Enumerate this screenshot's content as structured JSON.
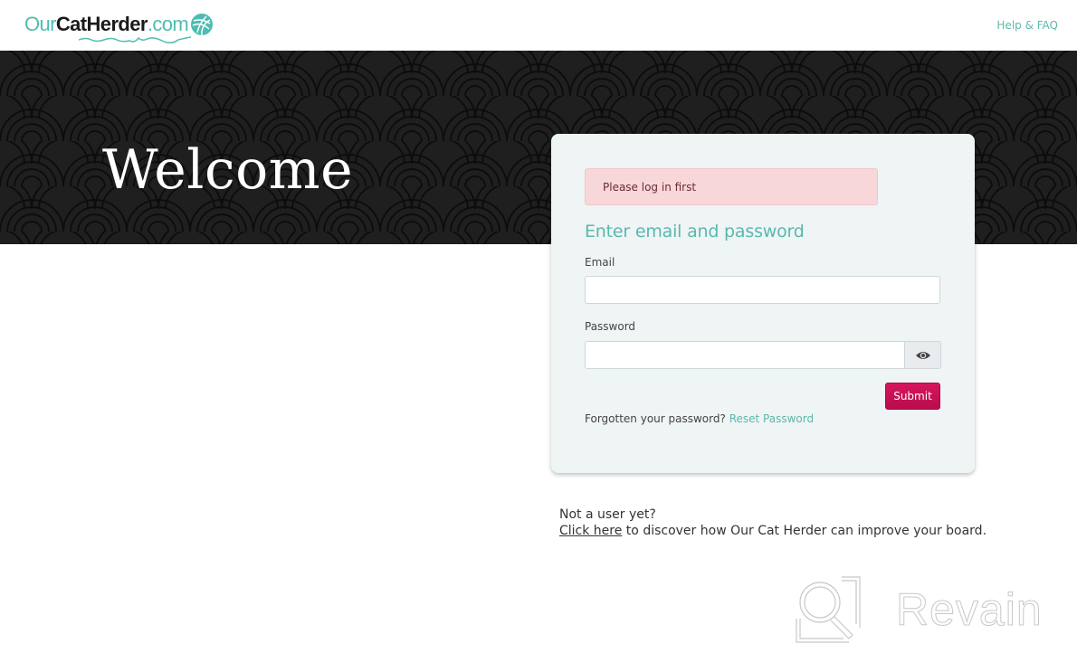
{
  "header": {
    "logo": {
      "part1": "Our",
      "part2": "CatHerder",
      "part3": ".com"
    },
    "help_link": "Help & FAQ"
  },
  "hero": {
    "title": "Welcome"
  },
  "login": {
    "alert": "Please log in first",
    "title": "Enter email and password",
    "email_label": "Email",
    "email_value": "",
    "password_label": "Password",
    "password_value": "",
    "show_password_icon": "eye-icon",
    "submit_label": "Submit",
    "forgot_text": "Forgotten your password?",
    "reset_link": "Reset Password"
  },
  "signup": {
    "question": "Not a user yet?",
    "link": "Click here",
    "text": " to discover how Our Cat Herder can improve your board."
  },
  "watermark": {
    "text": "Revain"
  },
  "colors": {
    "accent": "#5bb8ab",
    "submit": "#c8105a",
    "alert_bg": "#f7d7da",
    "hero_bg": "#1c1c1c"
  }
}
